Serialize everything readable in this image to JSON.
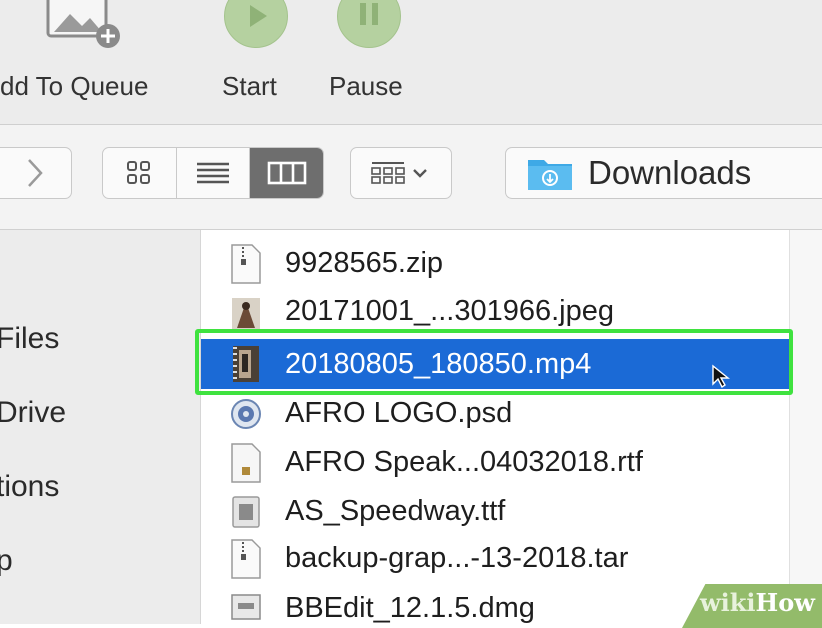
{
  "toolbar": {
    "add_to_queue_label": "dd To Queue",
    "start_label": "Start",
    "pause_label": "Pause",
    "icons": [
      "queue-add-icon",
      "play-icon",
      "pause-icon"
    ]
  },
  "navbar": {
    "forward_icon": "chevron-right-icon",
    "view_modes": [
      "icon-view",
      "list-view",
      "column-view"
    ],
    "active_view": "column-view",
    "arrange_icon": "group-grid-icon",
    "location": "Downloads"
  },
  "sidebar": {
    "items": [
      {
        "label": "Files"
      },
      {
        "label": "Drive"
      },
      {
        "label": "tions"
      },
      {
        "label": "p"
      }
    ]
  },
  "files": [
    {
      "name": "9928565.zip",
      "icon": "zip-file-icon",
      "selected": false
    },
    {
      "name": "20171001_...301966.jpeg",
      "icon": "image-file-icon",
      "selected": false
    },
    {
      "name": "20180805_180850.mp4",
      "icon": "video-file-icon",
      "selected": true
    },
    {
      "name": "AFRO LOGO.psd",
      "icon": "psd-file-icon",
      "selected": false
    },
    {
      "name": "AFRO Speak...04032018.rtf",
      "icon": "rtf-file-icon",
      "selected": false
    },
    {
      "name": "AS_Speedway.ttf",
      "icon": "font-file-icon",
      "selected": false
    },
    {
      "name": "backup-grap...-13-2018.tar",
      "icon": "tar-file-icon",
      "selected": false
    },
    {
      "name": "BBEdit_12.1.5.dmg",
      "icon": "dmg-file-icon",
      "selected": false
    }
  ],
  "colors": {
    "selection": "#1b6ad6",
    "highlight_outline": "#3fe23f",
    "toolbar_button": "#b5d1a0"
  },
  "watermark": {
    "part1": "wiki",
    "part2": "How"
  }
}
